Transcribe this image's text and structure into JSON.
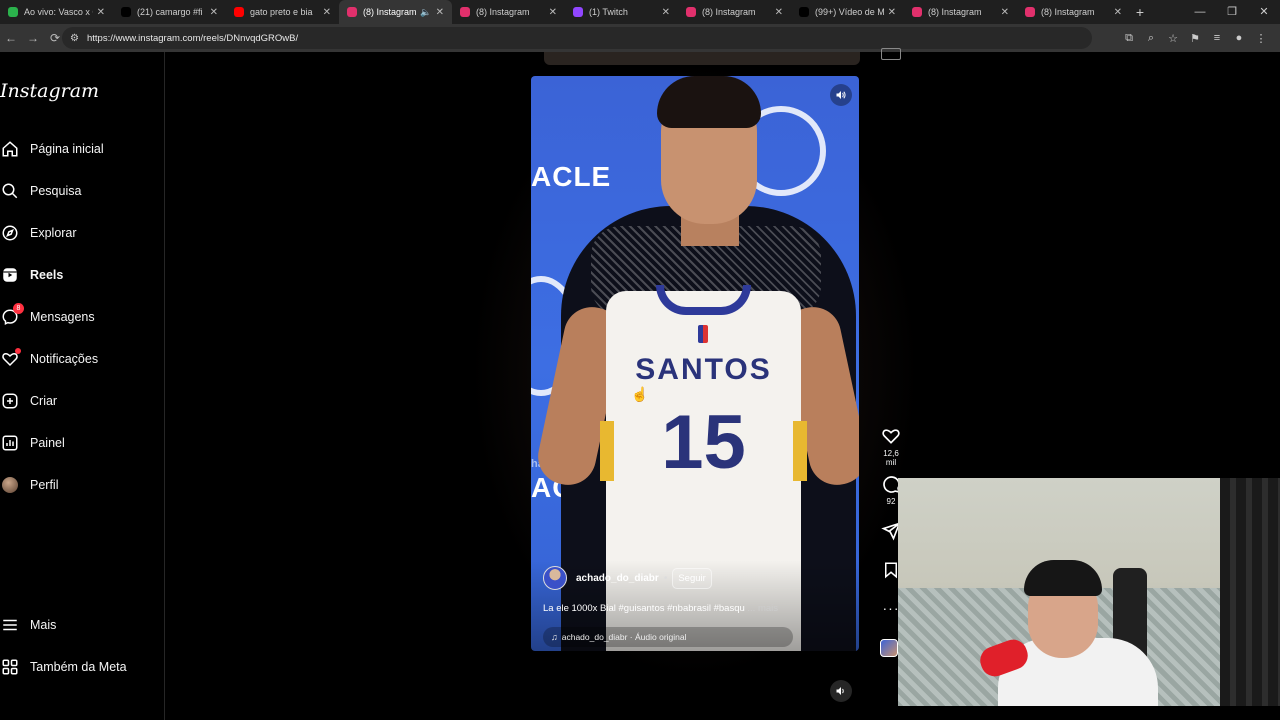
{
  "browser": {
    "tabs": [
      {
        "title": "Ao vivo: Vasco x C",
        "color": "#2bb24c",
        "active": false
      },
      {
        "title": "(21) camargo #fi",
        "color": "#000000",
        "active": false
      },
      {
        "title": "gato preto e bia",
        "color": "#ff0000",
        "active": false
      },
      {
        "title": "(8) Instagram",
        "color": "#e1306c",
        "active": true
      },
      {
        "title": "(8) Instagram",
        "color": "#e1306c",
        "active": false
      },
      {
        "title": "(1) Twitch",
        "color": "#9146ff",
        "active": false
      },
      {
        "title": "(8) Instagram",
        "color": "#e1306c",
        "active": false
      },
      {
        "title": "(99+) Vídeo de M",
        "color": "#000000",
        "active": false
      },
      {
        "title": "(8) Instagram",
        "color": "#e1306c",
        "active": false
      },
      {
        "title": "(8) Instagram",
        "color": "#e1306c",
        "active": false
      }
    ],
    "url": "https://www.instagram.com/reels/DNnvqdGROwB/"
  },
  "sidebar": {
    "logo": "Instagram",
    "items": [
      {
        "label": "Página inicial",
        "icon": "home-icon"
      },
      {
        "label": "Pesquisa",
        "icon": "search-icon"
      },
      {
        "label": "Explorar",
        "icon": "compass-icon"
      },
      {
        "label": "Reels",
        "icon": "reels-icon"
      },
      {
        "label": "Mensagens",
        "icon": "messenger-icon",
        "badge": "8"
      },
      {
        "label": "Notificações",
        "icon": "heart-icon"
      },
      {
        "label": "Criar",
        "icon": "plus-square-icon"
      },
      {
        "label": "Painel",
        "icon": "dashboard-icon"
      },
      {
        "label": "Perfil",
        "icon": "avatar"
      }
    ],
    "bottom": [
      {
        "label": "Mais",
        "icon": "menu-icon"
      },
      {
        "label": "Também da Meta",
        "icon": "meta-grid-icon"
      }
    ]
  },
  "reel": {
    "jersey_name": "SANTOS",
    "jersey_number": "15",
    "sponsor_text": "ACLE",
    "watermark": "hadoDoDiaBr",
    "author": "achado_do_diabr",
    "separator": "•",
    "follow_label": "Seguir",
    "caption": "La ele 1000x Bial #guisantos #nbabrasil #basqu",
    "caption_more": "... mais",
    "audio": "achado_do_diabr · Áudio original"
  },
  "actions": {
    "likes": "12,6 mil",
    "comments": "92"
  },
  "colors": {
    "accent_red": "#ff3040",
    "reel_bg": "#3d6ee3",
    "jersey_blue": "#2a337a"
  }
}
